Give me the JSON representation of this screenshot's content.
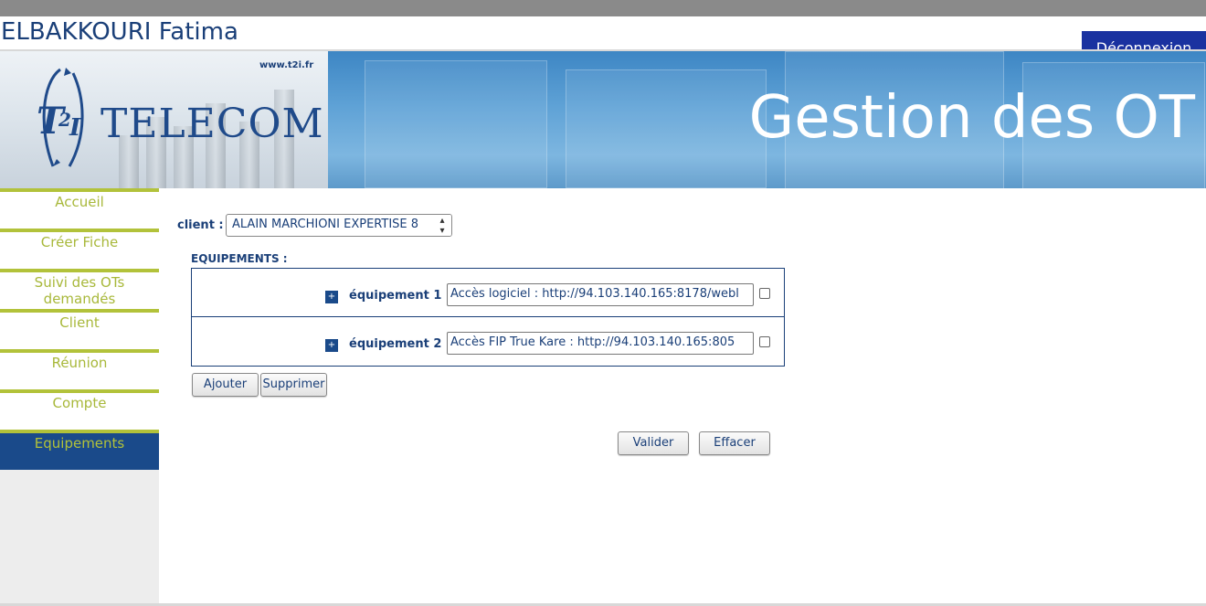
{
  "header": {
    "user_name": "ELBAKKOURI Fatima",
    "logout_label": "Déconnexion",
    "site_url": "www.t2i.fr",
    "logo_text": "TELECOM",
    "logo_mark_text": "T2I",
    "app_title": "Gestion des OT"
  },
  "sidebar": {
    "items": [
      {
        "label": "Accueil",
        "active": false
      },
      {
        "label": "Créer Fiche",
        "active": false
      },
      {
        "label": "Suivi des OTs demandés",
        "active": false
      },
      {
        "label": "Client",
        "active": false
      },
      {
        "label": "Réunion",
        "active": false
      },
      {
        "label": "Compte",
        "active": false
      },
      {
        "label": "Equipements",
        "active": true
      }
    ]
  },
  "form": {
    "client_label": "client :",
    "client_value": "ALAIN MARCHIONI EXPERTISE 8",
    "equipements_heading": "EQUIPEMENTS :",
    "equipements": [
      {
        "plus": "+",
        "label": "équipement 1 :",
        "value": "Accès logiciel : http://94.103.140.165:8178/webl",
        "checked": false
      },
      {
        "plus": "+",
        "label": "équipement 2 :",
        "value": "Accès FIP True Kare : http://94.103.140.165:805",
        "checked": false
      }
    ],
    "add_label": "Ajouter",
    "remove_label": "Supprimer",
    "submit_label": "Valider",
    "clear_label": "Effacer"
  },
  "colors": {
    "brand_blue": "#1a3f78",
    "accent_green": "#b2c23a",
    "active_nav": "#1a4a8a",
    "logout_bg": "#1a32a0"
  }
}
